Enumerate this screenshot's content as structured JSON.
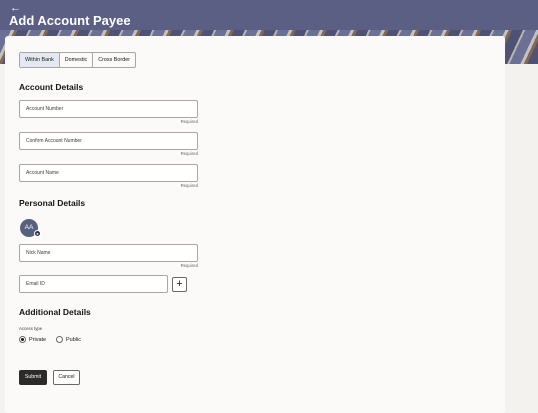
{
  "header": {
    "title": "Add Account Payee",
    "back_icon": "arrow-left-icon"
  },
  "tabs": [
    {
      "label": "Within Bank",
      "active": true
    },
    {
      "label": "Domestic",
      "active": false
    },
    {
      "label": "Cross Border",
      "active": false
    }
  ],
  "account_details": {
    "title": "Account Details",
    "account_number": {
      "placeholder": "Account Number",
      "hint": "Required"
    },
    "confirm_account_number": {
      "placeholder": "Confirm Account Number",
      "hint": "Required"
    },
    "account_name": {
      "placeholder": "Account Name",
      "hint": "Required"
    }
  },
  "personal_details": {
    "title": "Personal Details",
    "avatar_initials": "AA",
    "nick_name": {
      "placeholder": "Nick Name",
      "hint": "Required"
    },
    "email": {
      "placeholder": "Email ID"
    },
    "add_label": "+"
  },
  "additional_details": {
    "title": "Additional Details",
    "access_type_label": "Access type",
    "options": [
      {
        "label": "Private",
        "checked": true
      },
      {
        "label": "Public",
        "checked": false
      }
    ]
  },
  "actions": {
    "submit": "Submit",
    "cancel": "Cancel"
  },
  "colors": {
    "banner": "#5a5f83",
    "primary_button": "#2d2b29",
    "active_tab": "#e4e9f1"
  }
}
